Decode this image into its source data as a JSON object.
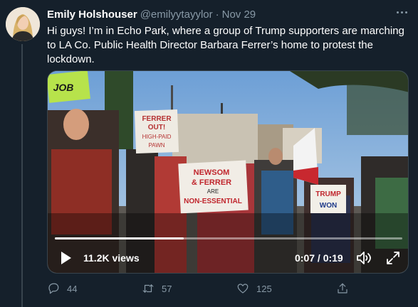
{
  "tweet": {
    "author_name": "Emily Holshouser",
    "handle": "@emilyytayylor",
    "separator": "·",
    "date": "Nov 29",
    "text": "Hi guys! I’m in Echo Park, where a group of Trump supporters are marching to LA Co. Public Health Director Barbara Ferrer’s home to protest the lockdown."
  },
  "video": {
    "views": "11.2K views",
    "time": "0:07 / 0:19",
    "progress_fraction": 0.37,
    "signs": {
      "sign1_line1": "FERRER",
      "sign1_line2": "OUT!",
      "sign1_line3": "HIGH-PAID",
      "sign1_line4": "PAWN",
      "sign2_line1": "NEWSOM",
      "sign2_line2": "& FERRER",
      "sign2_line3": "ARE",
      "sign2_line4": "NON-ESSENTIAL",
      "sign3_line1": "TRUMP",
      "sign3_line2": "WON",
      "sign4_text": "JOB"
    }
  },
  "actions": {
    "reply_count": "44",
    "retweet_count": "57",
    "like_count": "125"
  },
  "colors": {
    "background": "#15202b",
    "secondary_text": "#8899a6",
    "border": "#38444d"
  },
  "icons": {
    "more": "more-icon",
    "play": "play-icon",
    "volume": "volume-icon",
    "fullscreen": "fullscreen-icon",
    "reply": "reply-icon",
    "retweet": "retweet-icon",
    "like": "like-icon",
    "share": "share-icon"
  }
}
